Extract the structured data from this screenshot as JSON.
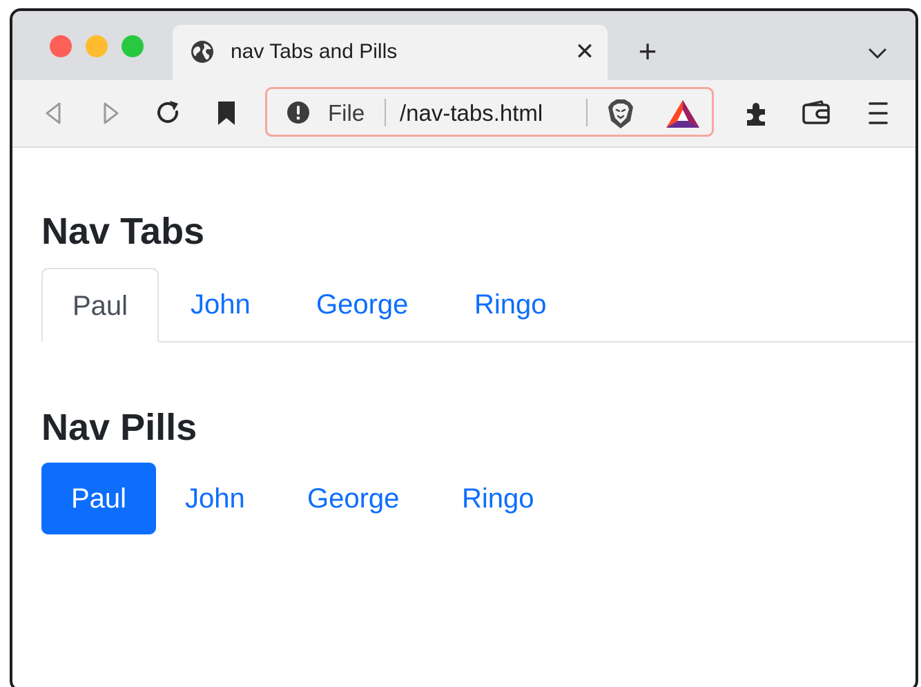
{
  "browser": {
    "tab": {
      "title": "nav Tabs and Pills",
      "close_glyph": "✕",
      "icon": "globe-icon"
    },
    "new_tab_glyph": "+",
    "address_bar": {
      "scheme_label": "File",
      "url": "/nav-tabs.html"
    }
  },
  "page": {
    "tabs_section": {
      "title": "Nav Tabs",
      "items": [
        {
          "label": "Paul",
          "active": true
        },
        {
          "label": "John",
          "active": false
        },
        {
          "label": "George",
          "active": false
        },
        {
          "label": "Ringo",
          "active": false
        }
      ]
    },
    "pills_section": {
      "title": "Nav Pills",
      "items": [
        {
          "label": "Paul",
          "active": true
        },
        {
          "label": "John",
          "active": false
        },
        {
          "label": "George",
          "active": false
        },
        {
          "label": "Ringo",
          "active": false
        }
      ]
    }
  },
  "colors": {
    "link": "#0d6efd",
    "active_pill_bg": "#0d6efd",
    "active_tab_text": "#495057",
    "address_border": "#f6a89f"
  }
}
